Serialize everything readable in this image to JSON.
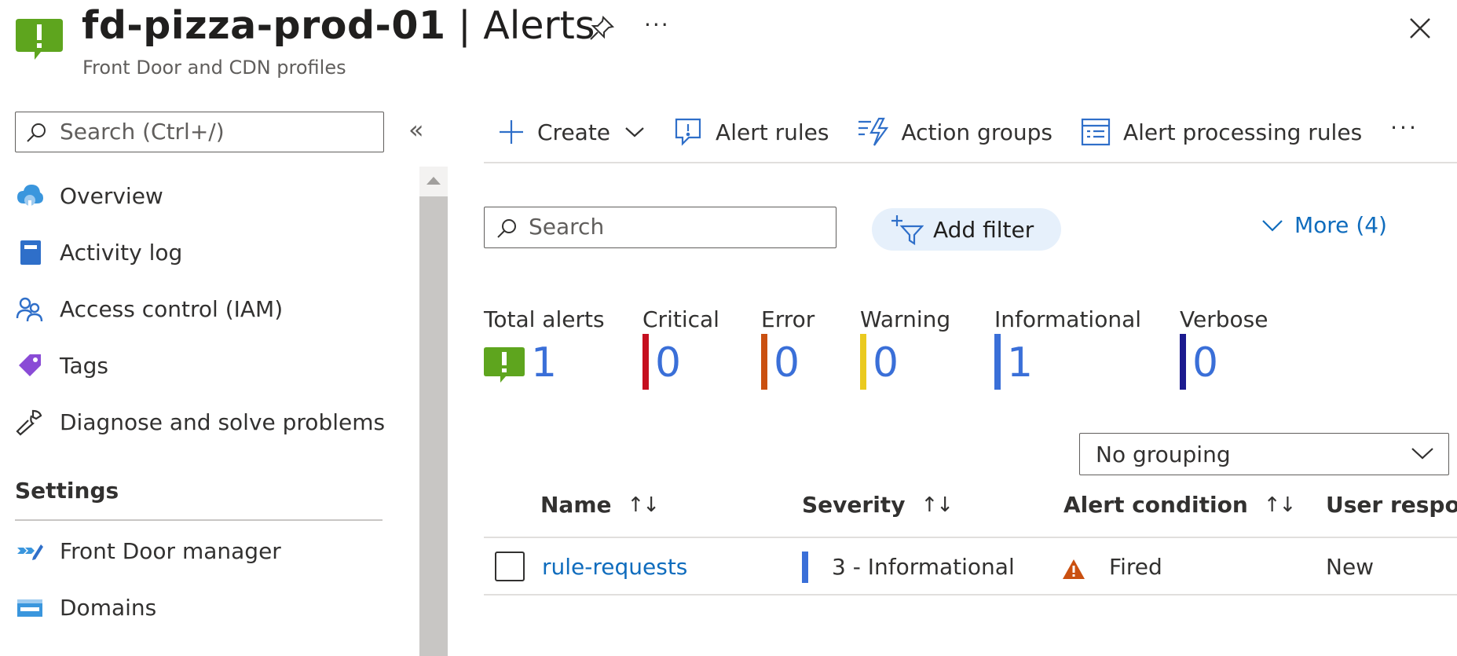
{
  "header": {
    "resource_name": "fd-pizza-prod-01",
    "separator": " | ",
    "page_name": "Alerts",
    "subtitle": "Front Door and CDN profiles",
    "more_label": "···"
  },
  "nav": {
    "search_placeholder": "Search (Ctrl+/)",
    "collapse_label": "«",
    "items": [
      {
        "label": "Overview",
        "icon": "overview-icon"
      },
      {
        "label": "Activity log",
        "icon": "activity-log-icon"
      },
      {
        "label": "Access control (IAM)",
        "icon": "iam-icon"
      },
      {
        "label": "Tags",
        "icon": "tag-icon"
      },
      {
        "label": "Diagnose and solve problems",
        "icon": "wrench-icon"
      }
    ],
    "settings_heading": "Settings",
    "settings_items": [
      {
        "label": "Front Door manager",
        "icon": "front-door-icon"
      },
      {
        "label": "Domains",
        "icon": "domains-icon"
      }
    ]
  },
  "toolbar": {
    "create_label": "Create",
    "alert_rules_label": "Alert rules",
    "action_groups_label": "Action groups",
    "processing_rules_label": "Alert processing rules",
    "more_label": "···"
  },
  "filters": {
    "search_placeholder": "Search",
    "add_filter_label": "Add filter",
    "more_label": "More (4)"
  },
  "summary": {
    "total": {
      "label": "Total alerts",
      "value": "1"
    },
    "critical": {
      "label": "Critical",
      "value": "0",
      "color": "#c50f1f"
    },
    "error": {
      "label": "Error",
      "value": "0",
      "color": "#ca5010"
    },
    "warning": {
      "label": "Warning",
      "value": "0",
      "color": "#eaca1f"
    },
    "informational": {
      "label": "Informational",
      "value": "1",
      "color": "#3a6fd8"
    },
    "verbose": {
      "label": "Verbose",
      "value": "0",
      "color": "#1b1a8f"
    }
  },
  "grouping": {
    "selected": "No grouping"
  },
  "table": {
    "columns": [
      "Name",
      "Severity",
      "Alert condition",
      "User respon"
    ],
    "sort_glyph": "↑↓",
    "rows": [
      {
        "name": "rule-requests",
        "severity": "3 - Informational",
        "condition": "Fired",
        "user_response": "New"
      }
    ]
  }
}
